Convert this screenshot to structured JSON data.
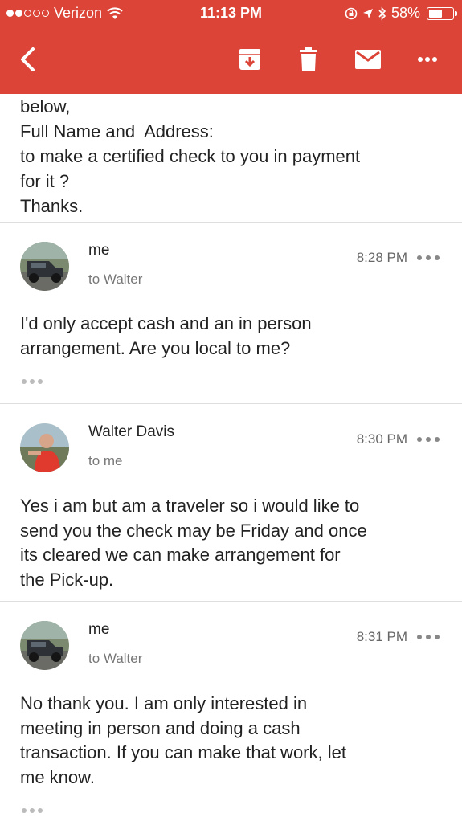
{
  "status_bar": {
    "carrier": "Verizon",
    "time": "11:13 PM",
    "battery": "58%",
    "battery_level": 0.58
  },
  "app_bar": {
    "icons": [
      "back-arrow-icon",
      "archive-icon",
      "trash-icon",
      "mark-unread-icon",
      "more-icon"
    ]
  },
  "previous_message": {
    "lines": [
      "below,",
      "Full Name and  Address:",
      "to make a certified check to you in payment",
      "for it ?",
      "Thanks."
    ]
  },
  "messages": [
    {
      "sender": "me",
      "recipient": "to Walter",
      "time": "8:28 PM",
      "lines": [
        "I'd only accept cash and an in person",
        "arrangement. Are you local to me?"
      ]
    },
    {
      "sender": "Walter Davis",
      "recipient": "to me",
      "time": "8:30 PM",
      "lines": [
        "Yes i am but am a traveler so i would like to",
        "send you the check may be Friday and once",
        "its cleared we can make arrangement for",
        "the Pick-up."
      ]
    },
    {
      "sender": "me",
      "recipient": "to Walter",
      "time": "8:31 PM",
      "lines": [
        "No thank you. I am only interested in",
        "meeting in person and doing a cash",
        "transaction. If you can make that work, let",
        "me know."
      ]
    }
  ],
  "colors": {
    "app_bar": "#db4437",
    "divider": "#dedede",
    "secondary_text": "#777777"
  }
}
